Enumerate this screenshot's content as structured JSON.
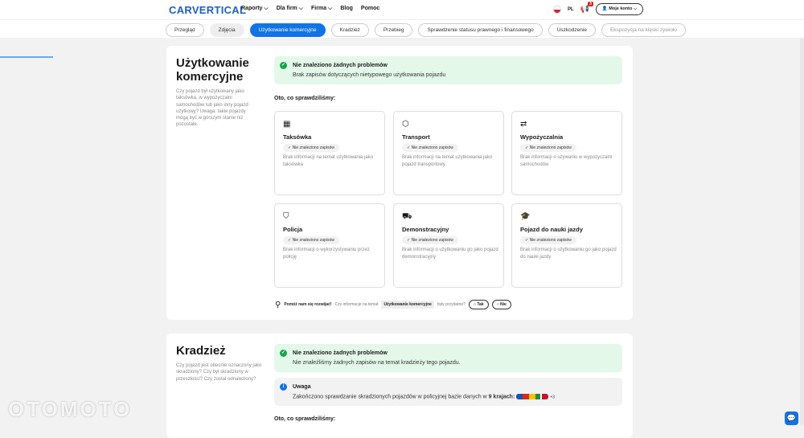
{
  "header": {
    "logo": "CARVERTICAL",
    "nav": [
      "Raporty ⌵",
      "Dla firm ⌵",
      "Firma ⌵",
      "Blog",
      "Pomoc"
    ],
    "lang": "PL",
    "notifications": "3",
    "account": "Moje konto ⌵"
  },
  "tabs": [
    "Przegląd",
    "Zdjęcia",
    "Użytkowanie komercyjne",
    "Kradzież",
    "Przebieg",
    "Sprawdzenie statusu prawnego i finansowego",
    "Uszkodzenie",
    "Ekspozycja na klęski żywioło"
  ],
  "commercial": {
    "title": "Użytkowanie komercyjne",
    "desc": "Czy pojazd był użytkowany jako taksówka, w wypożyczalni samochodów lub jako inny pojazd użytkowy? Uwaga: takie pojazdy mogą być w gorszym stanie niż pozostałe.",
    "ok_title": "Nie znaleziono żadnych problemów",
    "ok_text": "Brak zapisów dotyczących nietypowego użytkowania pojazdu",
    "checked": "Oto, co sprawdziliśmy:",
    "cards": [
      {
        "icon": "▦",
        "name": "Taksówka",
        "status": "✓ Nie znaleziono zapisów",
        "desc": "Brak informacji na temat użytkowania jako taksówka"
      },
      {
        "icon": "⬡",
        "name": "Transport",
        "status": "✓ Nie znaleziono zapisów",
        "desc": "Brak informacji na temat użytkowania jako pojazd transportowy"
      },
      {
        "icon": "⇄",
        "name": "Wypożyczalnia",
        "status": "✓ Nie znaleziono zapisów",
        "desc": "Brak informacji o używaniu w wypożyczalni samochodów"
      },
      {
        "icon": "⛉",
        "name": "Policja",
        "status": "✓ Nie znaleziono zapisów",
        "desc": "Brak informacji o wykorzystywaniu przez policję"
      },
      {
        "icon": "⛟",
        "name": "Demonstracyjny",
        "status": "✓ Nie znaleziono zapisów",
        "desc": "Brak informacji o użytkowaniu go jako pojazd demonstracyjny"
      },
      {
        "icon": "🎓",
        "name": "Pojazd do nauki jazdy",
        "status": "✓ Nie znaleziono zapisów",
        "desc": "Brak informacji o użytkowaniu go jako pojazd do nauki jazdy"
      }
    ],
    "feedback": {
      "lead": "Pomóż nam się rozwijać!",
      "q1": "Czy informacje na temat",
      "topic": "Użytkowanie komercyjne",
      "q2": "były przydatne?",
      "yes": "Tak",
      "no": "Nie"
    }
  },
  "theft": {
    "title": "Kradzież",
    "desc": "Czy pojazd jest obecnie oznaczony jako skradziony? Czy był skradziony w przeszłości? Czy został odnaleziony?",
    "ok_title": "Nie znaleziono żadnych problemów",
    "ok_text": "Nie znaleźliśmy żadnych zapisów na temat kradzieży tego pojazdu.",
    "note_title": "Uwaga",
    "note_text": "Zakończono sprawdzanie skradzionych pojazdów w policyjnej bazie danych w",
    "note_bold": "9 krajach:",
    "more": "+3",
    "checked": "Oto, co sprawdziliśmy:"
  },
  "watermark": "OTOMOTO"
}
